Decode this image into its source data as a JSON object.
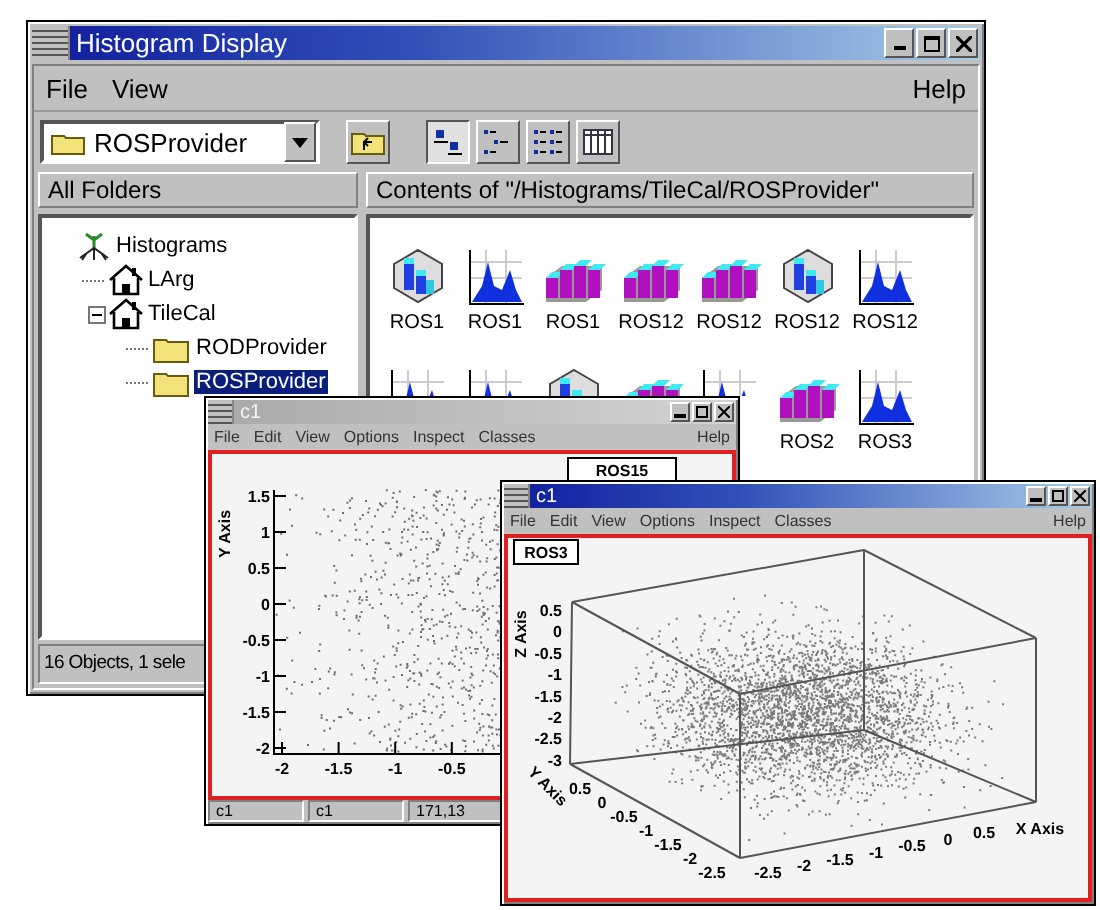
{
  "main_window": {
    "title": "Histogram Display",
    "menus": [
      {
        "label": "File"
      },
      {
        "label": "View"
      }
    ],
    "help_menu": "Help",
    "folder_combo": "ROSProvider",
    "view_modes": [
      {
        "kind": "large-icons",
        "selected": true
      },
      {
        "kind": "small-icons",
        "selected": false
      },
      {
        "kind": "list",
        "selected": false
      },
      {
        "kind": "details",
        "selected": false
      }
    ],
    "tree_header": "All Folders",
    "tree": [
      {
        "label": "Histograms",
        "kind": "root",
        "selected": false,
        "children": [
          {
            "label": "LArg",
            "kind": "house",
            "selected": false
          },
          {
            "label": "TileCal",
            "kind": "house",
            "selected": false,
            "children": [
              {
                "label": "RODProvider",
                "kind": "folder",
                "selected": false
              },
              {
                "label": "ROSProvider",
                "kind": "folder",
                "selected": true
              }
            ]
          }
        ]
      }
    ],
    "contents_header": "Contents of \"/Histograms/TileCal/ROSProvider\"",
    "items": [
      {
        "label": "ROS1",
        "kind": "lego"
      },
      {
        "label": "ROS1",
        "kind": "hist"
      },
      {
        "label": "ROS1",
        "kind": "bars"
      },
      {
        "label": "ROS12",
        "kind": "bars"
      },
      {
        "label": "ROS12",
        "kind": "bars"
      },
      {
        "label": "ROS12",
        "kind": "lego"
      },
      {
        "label": "ROS12",
        "kind": "hist"
      },
      {
        "kind": "hist"
      },
      {
        "kind": "hist"
      },
      {
        "kind": "lego"
      },
      {
        "kind": "bars"
      },
      {
        "kind": "hist"
      },
      {
        "label": "ROS2",
        "kind": "bars"
      },
      {
        "label": "ROS3",
        "kind": "hist"
      }
    ],
    "status": "16 Objects, 1 sele"
  },
  "canvas_windows": [
    {
      "title": "c1",
      "active": false,
      "menus": [
        "File",
        "Edit",
        "View",
        "Options",
        "Inspect",
        "Classes"
      ],
      "help_menu": "Help",
      "plot": {
        "kind": "scatter2d",
        "stats_title": "ROS15",
        "y_label": "Y Axis",
        "y_ticks": [
          "1.5",
          "1",
          "0.5",
          "0",
          "-0.5",
          "-1",
          "-1.5",
          "-2"
        ],
        "x_ticks": [
          "-2",
          "-1.5",
          "-1",
          "-0.5"
        ]
      },
      "status": [
        "c1",
        "c1",
        "171,13"
      ]
    },
    {
      "title": "c1",
      "active": true,
      "menus": [
        "File",
        "Edit",
        "View",
        "Options",
        "Inspect",
        "Classes"
      ],
      "help_menu": "Help",
      "plot": {
        "kind": "scatter3d",
        "stats_title": "ROS3",
        "z_label": "Z Axis",
        "z_ticks": [
          "0.5",
          "0",
          "-0.5",
          "-1",
          "-1.5",
          "-2",
          "-2.5",
          "-3"
        ],
        "y_label": "Y Axis",
        "y_ticks": [
          "0.5",
          "0",
          "-0.5",
          "-1",
          "-1.5",
          "-2",
          "-2.5"
        ],
        "x_label": "X Axis",
        "x_ticks": [
          "-2.5",
          "-2",
          "-1.5",
          "-1",
          "-0.5",
          "0",
          "0.5"
        ]
      }
    }
  ]
}
